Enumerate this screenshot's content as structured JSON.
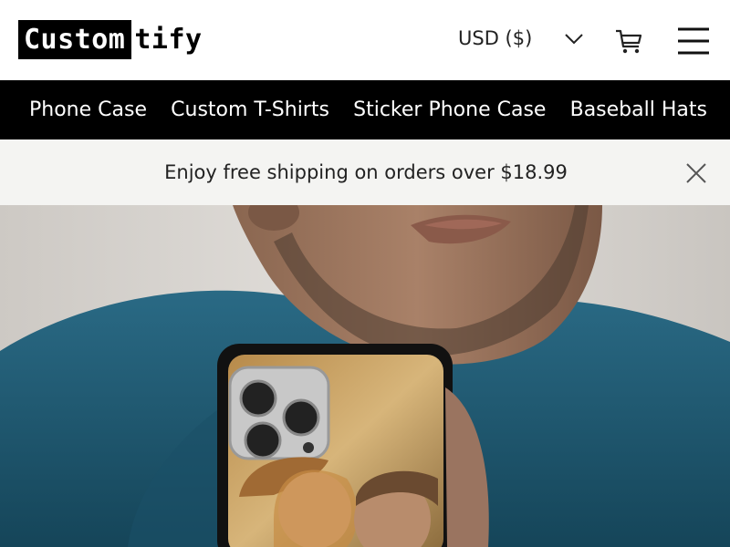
{
  "header": {
    "logo_boxed": "Custom",
    "logo_rest": "tify",
    "currency": "USD ($)"
  },
  "nav": {
    "items": [
      "Phone Case",
      "Custom T-Shirts",
      "Sticker Phone Case",
      "Baseball Hats"
    ]
  },
  "banner": {
    "text": "Enjoy free shipping on orders over $18.99"
  },
  "hero": {
    "image": "man-holding-custom-phone-case-photo"
  },
  "icons": {
    "currency_dropdown": "chevron-down-icon",
    "cart": "cart-icon",
    "menu": "hamburger-menu-icon",
    "close": "close-icon"
  },
  "colors": {
    "nav_bg": "#000000",
    "banner_bg": "#f4f4f2",
    "shirt": "#1e5a73"
  }
}
